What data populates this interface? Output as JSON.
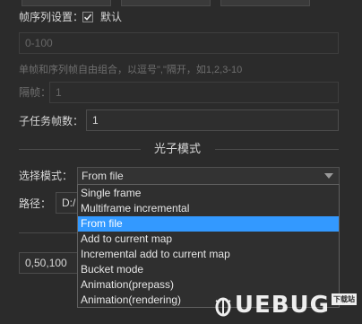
{
  "frame_sequence": {
    "label": "帧序列设置：",
    "default_checked": true,
    "default_label": "默认",
    "input_value": "0-100",
    "help_text": "单帧和序列帧自由组合，以逗号\",\"隔开，如1,2,3-10",
    "interval_label": "隔帧：",
    "interval_value": "1"
  },
  "subtask": {
    "label": "子任务帧数：",
    "value": "1"
  },
  "photon": {
    "section_title": "光子模式",
    "mode_label": "选择模式：",
    "selected_mode": "From file",
    "path_label": "路径：",
    "path_value": "D:/",
    "lower_field_value": "0,50,100",
    "options": [
      "Single frame",
      "Multiframe incremental",
      "From file",
      "Add to current map",
      "Incremental add to current map",
      "Bucket mode",
      "Animation(prepass)",
      "Animation(rendering)"
    ],
    "highlighted_index": 2
  },
  "watermark": {
    "text": "UEBUG",
    "badge": "下载站"
  },
  "colors": {
    "background": "#2b2b2b",
    "selection": "#3399ff"
  }
}
